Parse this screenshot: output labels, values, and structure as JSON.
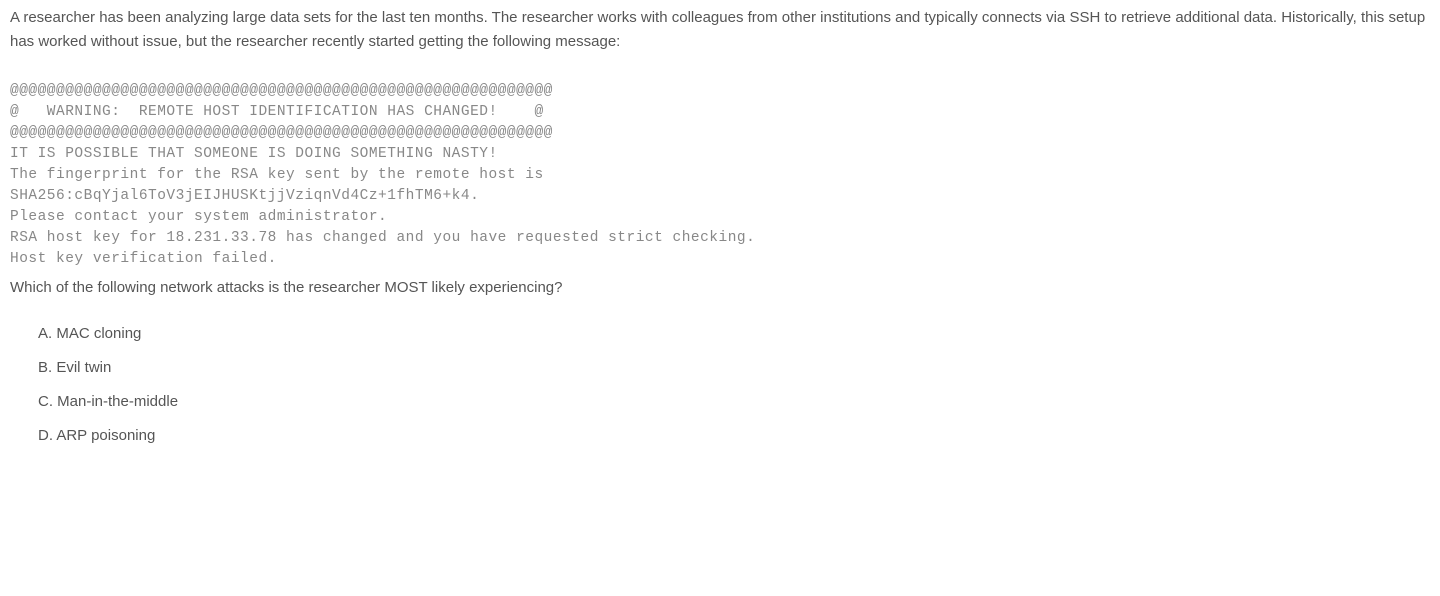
{
  "intro": "A researcher has been analyzing large data sets for the last ten months. The researcher works with colleagues from other institutions and typically connects via SSH to retrieve additional data. Historically, this setup has worked without issue, but the researcher recently started getting the following message:",
  "terminal": {
    "l1": "@@@@@@@@@@@@@@@@@@@@@@@@@@@@@@@@@@@@@@@@@@@@@@@@@@@@@@@@@@@",
    "l2": "@   WARNING:  REMOTE HOST IDENTIFICATION HAS CHANGED!    @",
    "l3": "@@@@@@@@@@@@@@@@@@@@@@@@@@@@@@@@@@@@@@@@@@@@@@@@@@@@@@@@@@@",
    "l4": "IT IS POSSIBLE THAT SOMEONE IS DOING SOMETHING NASTY!",
    "l5": "The fingerprint for the RSA key sent by the remote host is",
    "l6": "SHA256:cBqYjal6ToV3jEIJHUSKtjjVziqnVd4Cz+1fhTM6+k4.",
    "l7": "Please contact your system administrator.",
    "l8": "RSA host key for 18.231.33.78 has changed and you have requested strict checking.",
    "l9": "Host key verification failed."
  },
  "question": "Which of the following network attacks is the researcher MOST likely experiencing?",
  "options": {
    "a": "A. MAC cloning",
    "b": "B. Evil twin",
    "c": "C. Man-in-the-middle",
    "d": "D. ARP poisoning"
  }
}
